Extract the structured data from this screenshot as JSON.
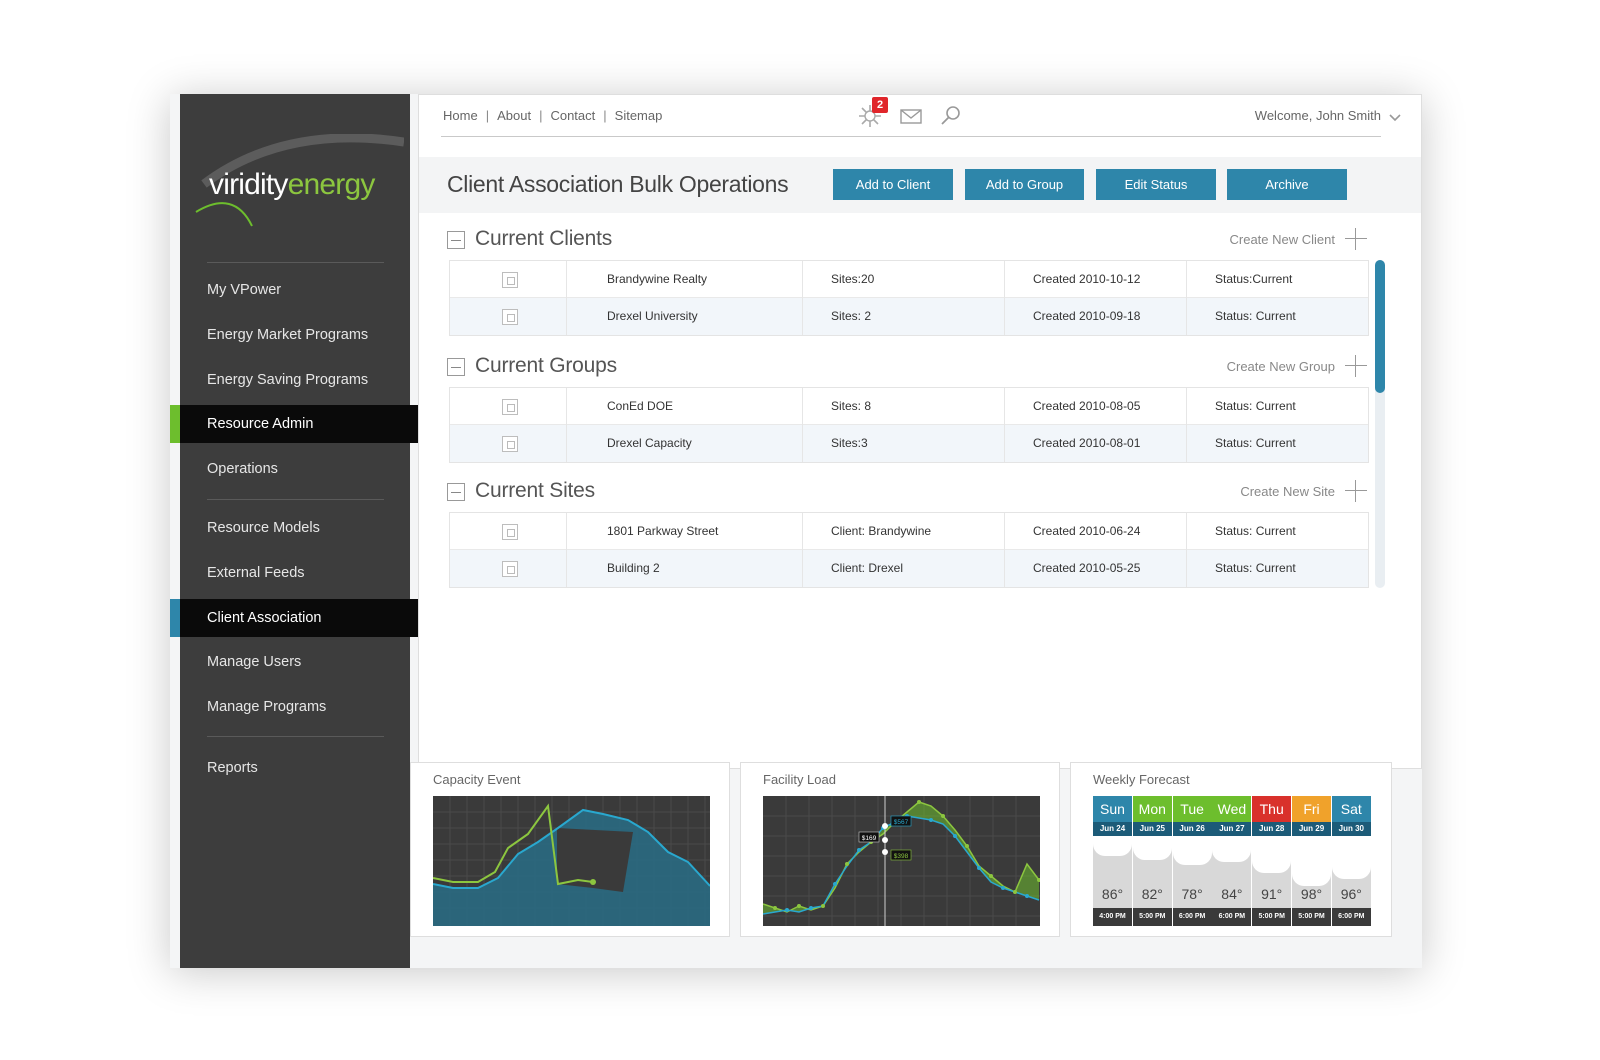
{
  "brand": {
    "logo_part1": "viridity",
    "logo_part2": "energy"
  },
  "colors": {
    "accent_green": "#6dbe2d",
    "accent_blue": "#2e86aa",
    "sidebar_bg": "#3d3d3d",
    "badge_red": "#e0262b"
  },
  "sidebar": {
    "items": [
      {
        "label": "My VPower"
      },
      {
        "label": "Energy Market Programs"
      },
      {
        "label": "Energy Saving Programs"
      },
      {
        "label": "Resource Admin",
        "active": true
      },
      {
        "label": "Operations"
      },
      {
        "label": "Resource Models"
      },
      {
        "label": "External Feeds"
      },
      {
        "label": "Client Association",
        "active": true
      },
      {
        "label": "Manage Users"
      },
      {
        "label": "Manage Programs"
      },
      {
        "label": "Reports"
      }
    ]
  },
  "topnav": {
    "links": [
      "Home",
      "About",
      "Contact",
      "Sitemap"
    ],
    "notifications_count": "2",
    "welcome": "Welcome, John Smith",
    "icons": [
      "notification-burst-icon",
      "mail-icon",
      "search-icon",
      "chevron-down-icon"
    ]
  },
  "page": {
    "title": "Client Association Bulk Operations",
    "actions": [
      "Add to Client",
      "Add to Group",
      "Edit Status",
      "Archive"
    ]
  },
  "sections": [
    {
      "title": "Current Clients",
      "create_label": "Create New Client",
      "rows": [
        {
          "name": "Brandywine Realty",
          "info": "Sites:20",
          "created": "Created 2010-10-12",
          "status": "Status:Current"
        },
        {
          "name": "Drexel University",
          "info": "Sites: 2",
          "created": "Created 2010-09-18",
          "status": "Status: Current"
        }
      ]
    },
    {
      "title": "Current Groups",
      "create_label": "Create New Group",
      "rows": [
        {
          "name": "ConEd DOE",
          "info": "Sites: 8",
          "created": "Created 2010-08-05",
          "status": "Status: Current"
        },
        {
          "name": "Drexel Capacity",
          "info": "Sites:3",
          "created": "Created 2010-08-01",
          "status": "Status: Current"
        }
      ]
    },
    {
      "title": "Current Sites",
      "create_label": "Create New Site",
      "rows": [
        {
          "name": "1801 Parkway Street",
          "info": "Client: Brandywine",
          "created": "Created 2010-06-24",
          "status": "Status: Current"
        },
        {
          "name": "Building 2",
          "info": "Client: Drexel",
          "created": "Created 2010-05-25",
          "status": "Status: Current"
        }
      ]
    }
  ],
  "widgets": {
    "capacity_event": {
      "title": "Capacity Event"
    },
    "facility_load": {
      "title": "Facility Load",
      "tags": [
        "$567",
        "$169",
        "$398"
      ]
    },
    "weekly_forecast": {
      "title": "Weekly Forecast",
      "days": [
        {
          "day": "Sun",
          "date": "Jun 24",
          "temp": "86°",
          "time": "4:00 PM",
          "color": "#2e86aa"
        },
        {
          "day": "Mon",
          "date": "Jun 25",
          "temp": "82°",
          "time": "5:00 PM",
          "color": "#6dbe2d"
        },
        {
          "day": "Tue",
          "date": "Jun 26",
          "temp": "78°",
          "time": "6:00 PM",
          "color": "#6dbe2d"
        },
        {
          "day": "Wed",
          "date": "Jun 27",
          "temp": "84°",
          "time": "6:00 PM",
          "color": "#6dbe2d"
        },
        {
          "day": "Thu",
          "date": "Jun 28",
          "temp": "91°",
          "time": "5:00 PM",
          "color": "#d9312b"
        },
        {
          "day": "Fri",
          "date": "Jun 29",
          "temp": "98°",
          "time": "5:00 PM",
          "color": "#f0a22b"
        },
        {
          "day": "Sat",
          "date": "Jun 30",
          "temp": "96°",
          "time": "6:00 PM",
          "color": "#2e86aa"
        }
      ]
    }
  }
}
